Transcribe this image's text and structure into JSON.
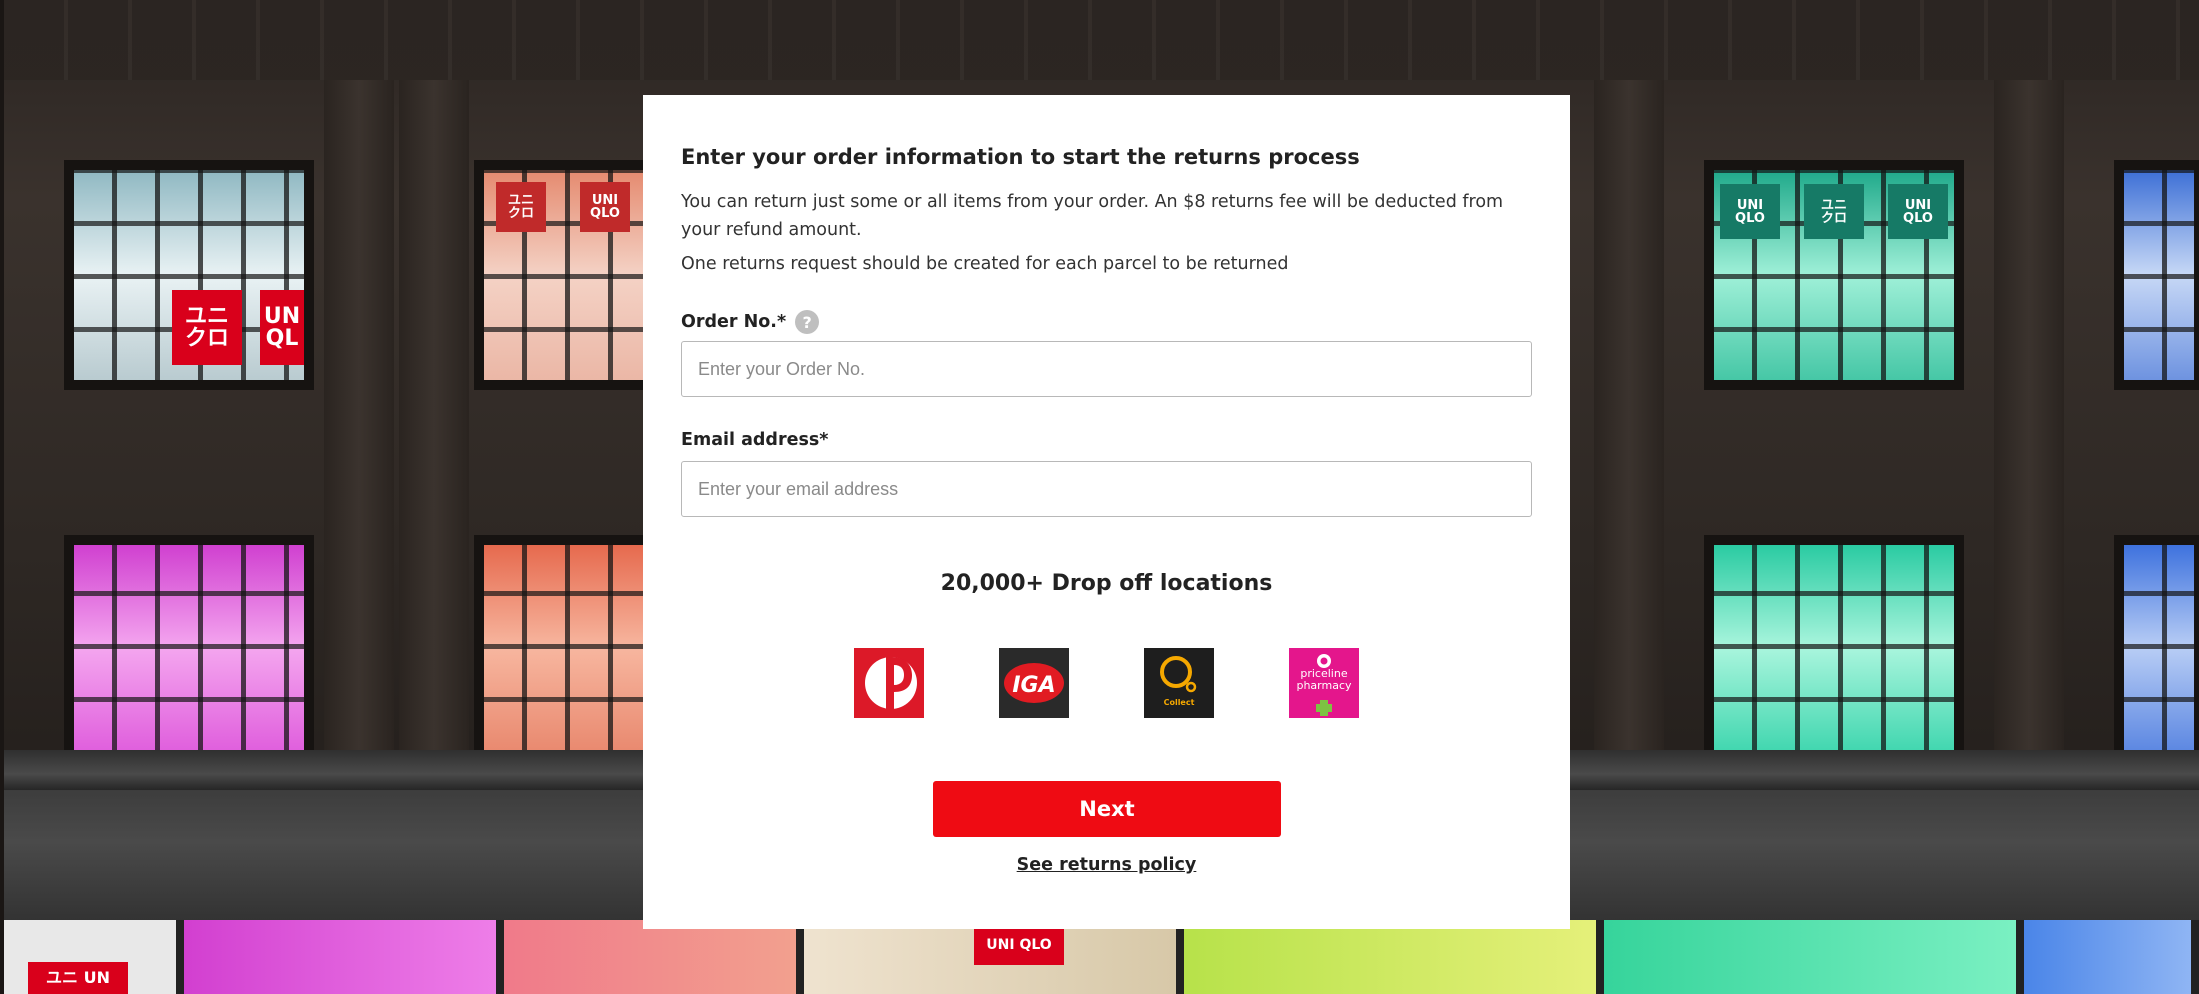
{
  "form": {
    "title": "Enter your order information to start the returns process",
    "intro": "You can return just some or all items from your order. An $8 returns fee will be deducted from your refund amount.",
    "note": "One returns request should be created for each parcel to be returned",
    "order_label": "Order No.*",
    "order_help_glyph": "?",
    "order_placeholder": "Enter your Order No.",
    "order_value": "",
    "email_label": "Email address*",
    "email_placeholder": "Enter your email address",
    "email_value": ""
  },
  "dropoff": {
    "title": "20,000+ Drop off locations",
    "carriers": [
      {
        "name": "australia-post-logo",
        "color": "#dc1928"
      },
      {
        "name": "igr-logo",
        "text": "IGA",
        "color": "#2a2a2a"
      },
      {
        "name": "collect-logo",
        "text": "Collect",
        "color": "#1e1e1e"
      },
      {
        "name": "priceline-logo",
        "text": "priceline pharmacy",
        "color": "#e4168c"
      }
    ]
  },
  "actions": {
    "next_label": "Next",
    "policy_label": "See returns policy"
  },
  "background": {
    "store_sign_top": "UNI QLO",
    "store_sign_jp": "ユニ クロ"
  },
  "colors": {
    "accent": "#ef0b13",
    "card": "#ffffff",
    "text": "#222222"
  }
}
